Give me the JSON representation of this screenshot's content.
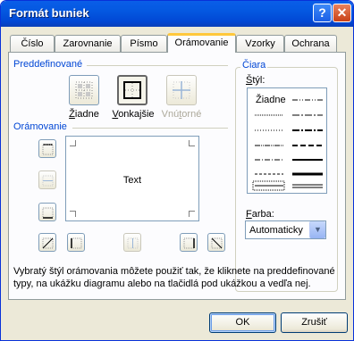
{
  "window": {
    "title": "Formát buniek"
  },
  "title_buttons": {
    "help": "?",
    "close": "✕"
  },
  "tabs": [
    {
      "label": "Číslo"
    },
    {
      "label": "Zarovnanie"
    },
    {
      "label": "Písmo"
    },
    {
      "label": "Orámovanie"
    },
    {
      "label": "Vzorky"
    },
    {
      "label": "Ochrana"
    }
  ],
  "active_tab": "Orámovanie",
  "presets": {
    "group_label": "Preddefinované",
    "items": [
      {
        "label": "Žiadne",
        "state": "normal"
      },
      {
        "label": "Vonkajšie",
        "state": "pressed"
      },
      {
        "label": "Vnútorné",
        "state": "disabled"
      }
    ]
  },
  "border": {
    "group_label": "Orámovanie",
    "preview_text": "Text"
  },
  "line": {
    "group_label": "Čiara",
    "style_label": "Štýl:",
    "none_label": "Žiadne",
    "color_label": "Farba:",
    "color_value": "Automaticky"
  },
  "description": "Vybratý štýl orámovania môžete použiť tak, že kliknete na preddefinované typy, na ukážku diagramu alebo na tlačidlá pod ukážkou a vedľa nej.",
  "buttons": {
    "ok": "OK",
    "cancel": "Zrušiť"
  },
  "colors": {
    "titlebar": "#0458e0",
    "group_label": "#0046d5",
    "dialog_bg": "#ece9d8",
    "active_tab_accent": "#ffc83c"
  }
}
